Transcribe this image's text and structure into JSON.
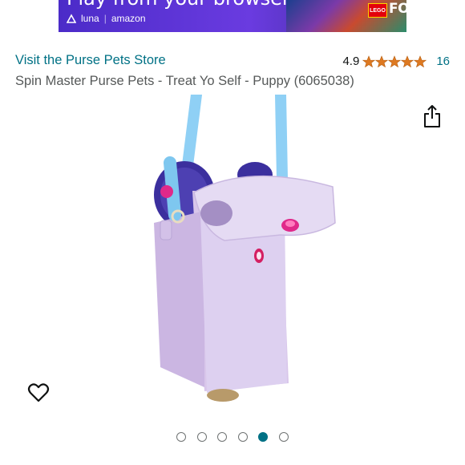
{
  "ad": {
    "headline": "Play from your browser",
    "brand_luna": "luna",
    "brand_amazon": "amazon",
    "lego": "LEGO",
    "fortnite": "FORTNITE"
  },
  "store": {
    "link_text": "Visit the Purse Pets Store"
  },
  "rating": {
    "value": "4.9",
    "stars": 5,
    "count": "16",
    "star_color": "#de7921"
  },
  "product": {
    "title": "Spin Master Purse Pets - Treat Yo Self - Puppy (6065038)",
    "image_icon": "lavender-puppy-purse"
  },
  "carousel": {
    "total": 6,
    "active_index": 4,
    "active_color": "#007185"
  },
  "icons": {
    "share": "share-icon",
    "wishlist": "heart-icon"
  }
}
